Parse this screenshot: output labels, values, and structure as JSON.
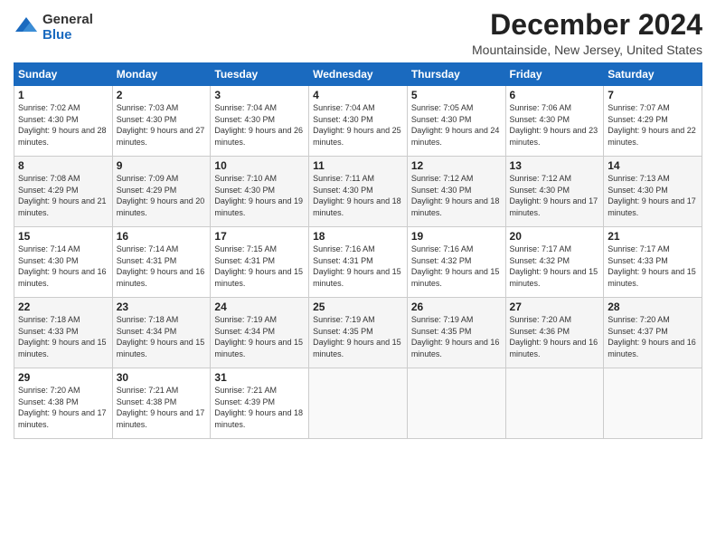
{
  "logo": {
    "general": "General",
    "blue": "Blue"
  },
  "title": "December 2024",
  "location": "Mountainside, New Jersey, United States",
  "days_header": [
    "Sunday",
    "Monday",
    "Tuesday",
    "Wednesday",
    "Thursday",
    "Friday",
    "Saturday"
  ],
  "weeks": [
    [
      {
        "day": "1",
        "sunrise": "7:02 AM",
        "sunset": "4:30 PM",
        "daylight": "9 hours and 28 minutes."
      },
      {
        "day": "2",
        "sunrise": "7:03 AM",
        "sunset": "4:30 PM",
        "daylight": "9 hours and 27 minutes."
      },
      {
        "day": "3",
        "sunrise": "7:04 AM",
        "sunset": "4:30 PM",
        "daylight": "9 hours and 26 minutes."
      },
      {
        "day": "4",
        "sunrise": "7:04 AM",
        "sunset": "4:30 PM",
        "daylight": "9 hours and 25 minutes."
      },
      {
        "day": "5",
        "sunrise": "7:05 AM",
        "sunset": "4:30 PM",
        "daylight": "9 hours and 24 minutes."
      },
      {
        "day": "6",
        "sunrise": "7:06 AM",
        "sunset": "4:30 PM",
        "daylight": "9 hours and 23 minutes."
      },
      {
        "day": "7",
        "sunrise": "7:07 AM",
        "sunset": "4:29 PM",
        "daylight": "9 hours and 22 minutes."
      }
    ],
    [
      {
        "day": "8",
        "sunrise": "7:08 AM",
        "sunset": "4:29 PM",
        "daylight": "9 hours and 21 minutes."
      },
      {
        "day": "9",
        "sunrise": "7:09 AM",
        "sunset": "4:29 PM",
        "daylight": "9 hours and 20 minutes."
      },
      {
        "day": "10",
        "sunrise": "7:10 AM",
        "sunset": "4:30 PM",
        "daylight": "9 hours and 19 minutes."
      },
      {
        "day": "11",
        "sunrise": "7:11 AM",
        "sunset": "4:30 PM",
        "daylight": "9 hours and 18 minutes."
      },
      {
        "day": "12",
        "sunrise": "7:12 AM",
        "sunset": "4:30 PM",
        "daylight": "9 hours and 18 minutes."
      },
      {
        "day": "13",
        "sunrise": "7:12 AM",
        "sunset": "4:30 PM",
        "daylight": "9 hours and 17 minutes."
      },
      {
        "day": "14",
        "sunrise": "7:13 AM",
        "sunset": "4:30 PM",
        "daylight": "9 hours and 17 minutes."
      }
    ],
    [
      {
        "day": "15",
        "sunrise": "7:14 AM",
        "sunset": "4:30 PM",
        "daylight": "9 hours and 16 minutes."
      },
      {
        "day": "16",
        "sunrise": "7:14 AM",
        "sunset": "4:31 PM",
        "daylight": "9 hours and 16 minutes."
      },
      {
        "day": "17",
        "sunrise": "7:15 AM",
        "sunset": "4:31 PM",
        "daylight": "9 hours and 15 minutes."
      },
      {
        "day": "18",
        "sunrise": "7:16 AM",
        "sunset": "4:31 PM",
        "daylight": "9 hours and 15 minutes."
      },
      {
        "day": "19",
        "sunrise": "7:16 AM",
        "sunset": "4:32 PM",
        "daylight": "9 hours and 15 minutes."
      },
      {
        "day": "20",
        "sunrise": "7:17 AM",
        "sunset": "4:32 PM",
        "daylight": "9 hours and 15 minutes."
      },
      {
        "day": "21",
        "sunrise": "7:17 AM",
        "sunset": "4:33 PM",
        "daylight": "9 hours and 15 minutes."
      }
    ],
    [
      {
        "day": "22",
        "sunrise": "7:18 AM",
        "sunset": "4:33 PM",
        "daylight": "9 hours and 15 minutes."
      },
      {
        "day": "23",
        "sunrise": "7:18 AM",
        "sunset": "4:34 PM",
        "daylight": "9 hours and 15 minutes."
      },
      {
        "day": "24",
        "sunrise": "7:19 AM",
        "sunset": "4:34 PM",
        "daylight": "9 hours and 15 minutes."
      },
      {
        "day": "25",
        "sunrise": "7:19 AM",
        "sunset": "4:35 PM",
        "daylight": "9 hours and 15 minutes."
      },
      {
        "day": "26",
        "sunrise": "7:19 AM",
        "sunset": "4:35 PM",
        "daylight": "9 hours and 16 minutes."
      },
      {
        "day": "27",
        "sunrise": "7:20 AM",
        "sunset": "4:36 PM",
        "daylight": "9 hours and 16 minutes."
      },
      {
        "day": "28",
        "sunrise": "7:20 AM",
        "sunset": "4:37 PM",
        "daylight": "9 hours and 16 minutes."
      }
    ],
    [
      {
        "day": "29",
        "sunrise": "7:20 AM",
        "sunset": "4:38 PM",
        "daylight": "9 hours and 17 minutes."
      },
      {
        "day": "30",
        "sunrise": "7:21 AM",
        "sunset": "4:38 PM",
        "daylight": "9 hours and 17 minutes."
      },
      {
        "day": "31",
        "sunrise": "7:21 AM",
        "sunset": "4:39 PM",
        "daylight": "9 hours and 18 minutes."
      },
      null,
      null,
      null,
      null
    ]
  ],
  "labels": {
    "sunrise": "Sunrise:",
    "sunset": "Sunset:",
    "daylight": "Daylight:"
  }
}
